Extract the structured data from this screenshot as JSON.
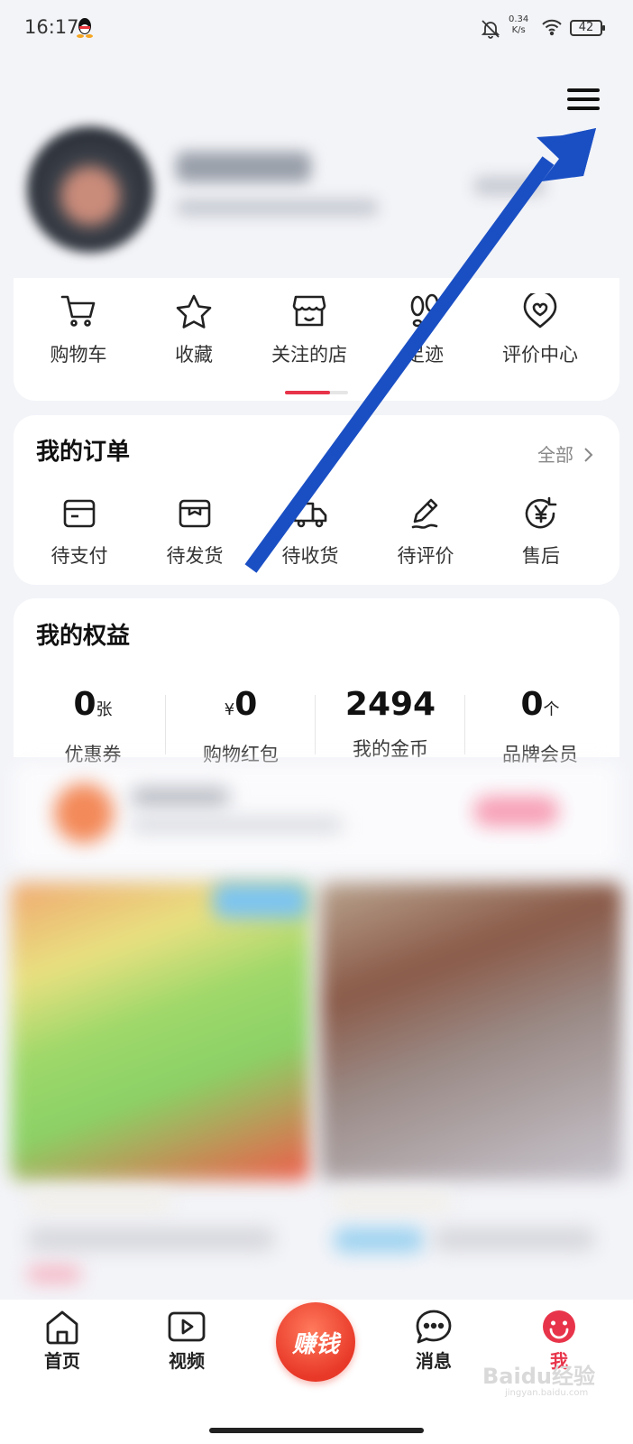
{
  "status_bar": {
    "time": "16:17",
    "network_speed_value": "0.34",
    "network_speed_unit": "K/s",
    "battery": "42"
  },
  "quick_links": [
    {
      "label": "购物车",
      "icon": "cart-icon"
    },
    {
      "label": "收藏",
      "icon": "star-icon"
    },
    {
      "label": "关注的店",
      "icon": "store-icon"
    },
    {
      "label": "足迹",
      "icon": "footprint-icon"
    },
    {
      "label": "评价中心",
      "icon": "review-center-icon"
    }
  ],
  "orders": {
    "title": "我的订单",
    "all_label": "全部",
    "items": [
      {
        "label": "待支付",
        "icon": "wallet-icon"
      },
      {
        "label": "待发货",
        "icon": "box-icon"
      },
      {
        "label": "待收货",
        "icon": "truck-icon"
      },
      {
        "label": "待评价",
        "icon": "pen-icon"
      },
      {
        "label": "售后",
        "icon": "refund-icon"
      }
    ]
  },
  "benefits": {
    "title": "我的权益",
    "items": [
      {
        "prefix": "",
        "value": "0",
        "unit": "张",
        "label": "优惠券"
      },
      {
        "prefix": "¥",
        "value": "0",
        "unit": "",
        "label": "购物红包"
      },
      {
        "prefix": "",
        "value": "2494",
        "unit": "",
        "label": "我的金币"
      },
      {
        "prefix": "",
        "value": "0",
        "unit": "个",
        "label": "品牌会员"
      }
    ]
  },
  "tab_bar": {
    "items": [
      {
        "label": "首页",
        "icon": "home-icon"
      },
      {
        "label": "视频",
        "icon": "video-icon"
      },
      {
        "label": "消息",
        "icon": "message-icon"
      },
      {
        "label": "我",
        "icon": "me-icon",
        "active": true
      }
    ],
    "earn_label": "赚钱"
  },
  "watermark": {
    "text": "Baidu经验",
    "sub": "jingyan.baidu.com"
  },
  "colors": {
    "accent": "#e8344a",
    "arrow": "#1a4fc4",
    "background": "#f3f4f8"
  }
}
